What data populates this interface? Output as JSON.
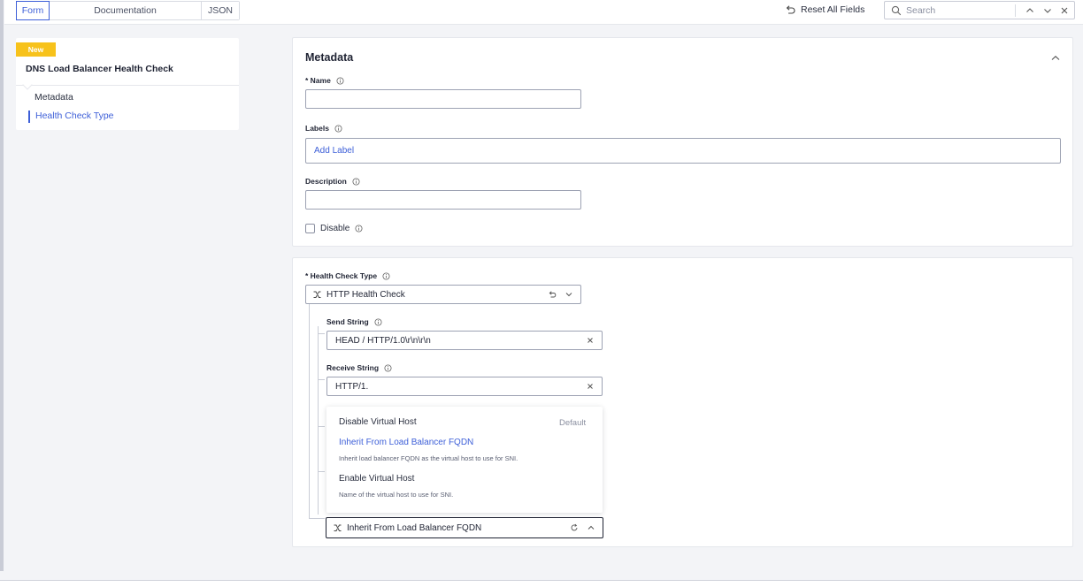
{
  "topbar": {
    "tabs": [
      {
        "label": "Form",
        "active": true
      },
      {
        "label": "Documentation",
        "active": false
      },
      {
        "label": "JSON",
        "active": false
      }
    ],
    "reset_label": "Reset All Fields",
    "search_placeholder": "Search"
  },
  "nav": {
    "badge": "New",
    "title": "DNS Load Balancer Health Check",
    "items": [
      {
        "label": "Metadata",
        "active": false
      },
      {
        "label": "Health Check Type",
        "active": true
      }
    ]
  },
  "metadata": {
    "title": "Metadata",
    "name_label": "* Name",
    "name_value": "",
    "labels_label": "Labels",
    "labels_placeholder": "Add Label",
    "description_label": "Description",
    "description_value": "",
    "disable_label": "Disable",
    "disable_checked": false
  },
  "health_check": {
    "type_label": "* Health Check Type",
    "type_value": "HTTP Health Check",
    "send_label": "Send String",
    "send_value": "HEAD / HTTP/1.0\\r\\n\\r\\n",
    "receive_label": "Receive String",
    "receive_value": "HTTP/1.",
    "dropdown": {
      "options": [
        {
          "label": "Disable Virtual Host",
          "tag": "Default",
          "description": ""
        },
        {
          "label": "Inherit From Load Balancer FQDN",
          "tag": "",
          "description": "Inherit load balancer FQDN as the virtual host to use for SNI.",
          "selected": true
        },
        {
          "label": "Enable Virtual Host",
          "tag": "",
          "description": "Name of the virtual host to use for SNI."
        }
      ]
    },
    "host_value": "Inherit From Load Balancer FQDN"
  },
  "colors": {
    "accent": "#3d5fd8",
    "badge": "#f7c21b",
    "text": "#1f2333",
    "border": "#9da2b3"
  }
}
